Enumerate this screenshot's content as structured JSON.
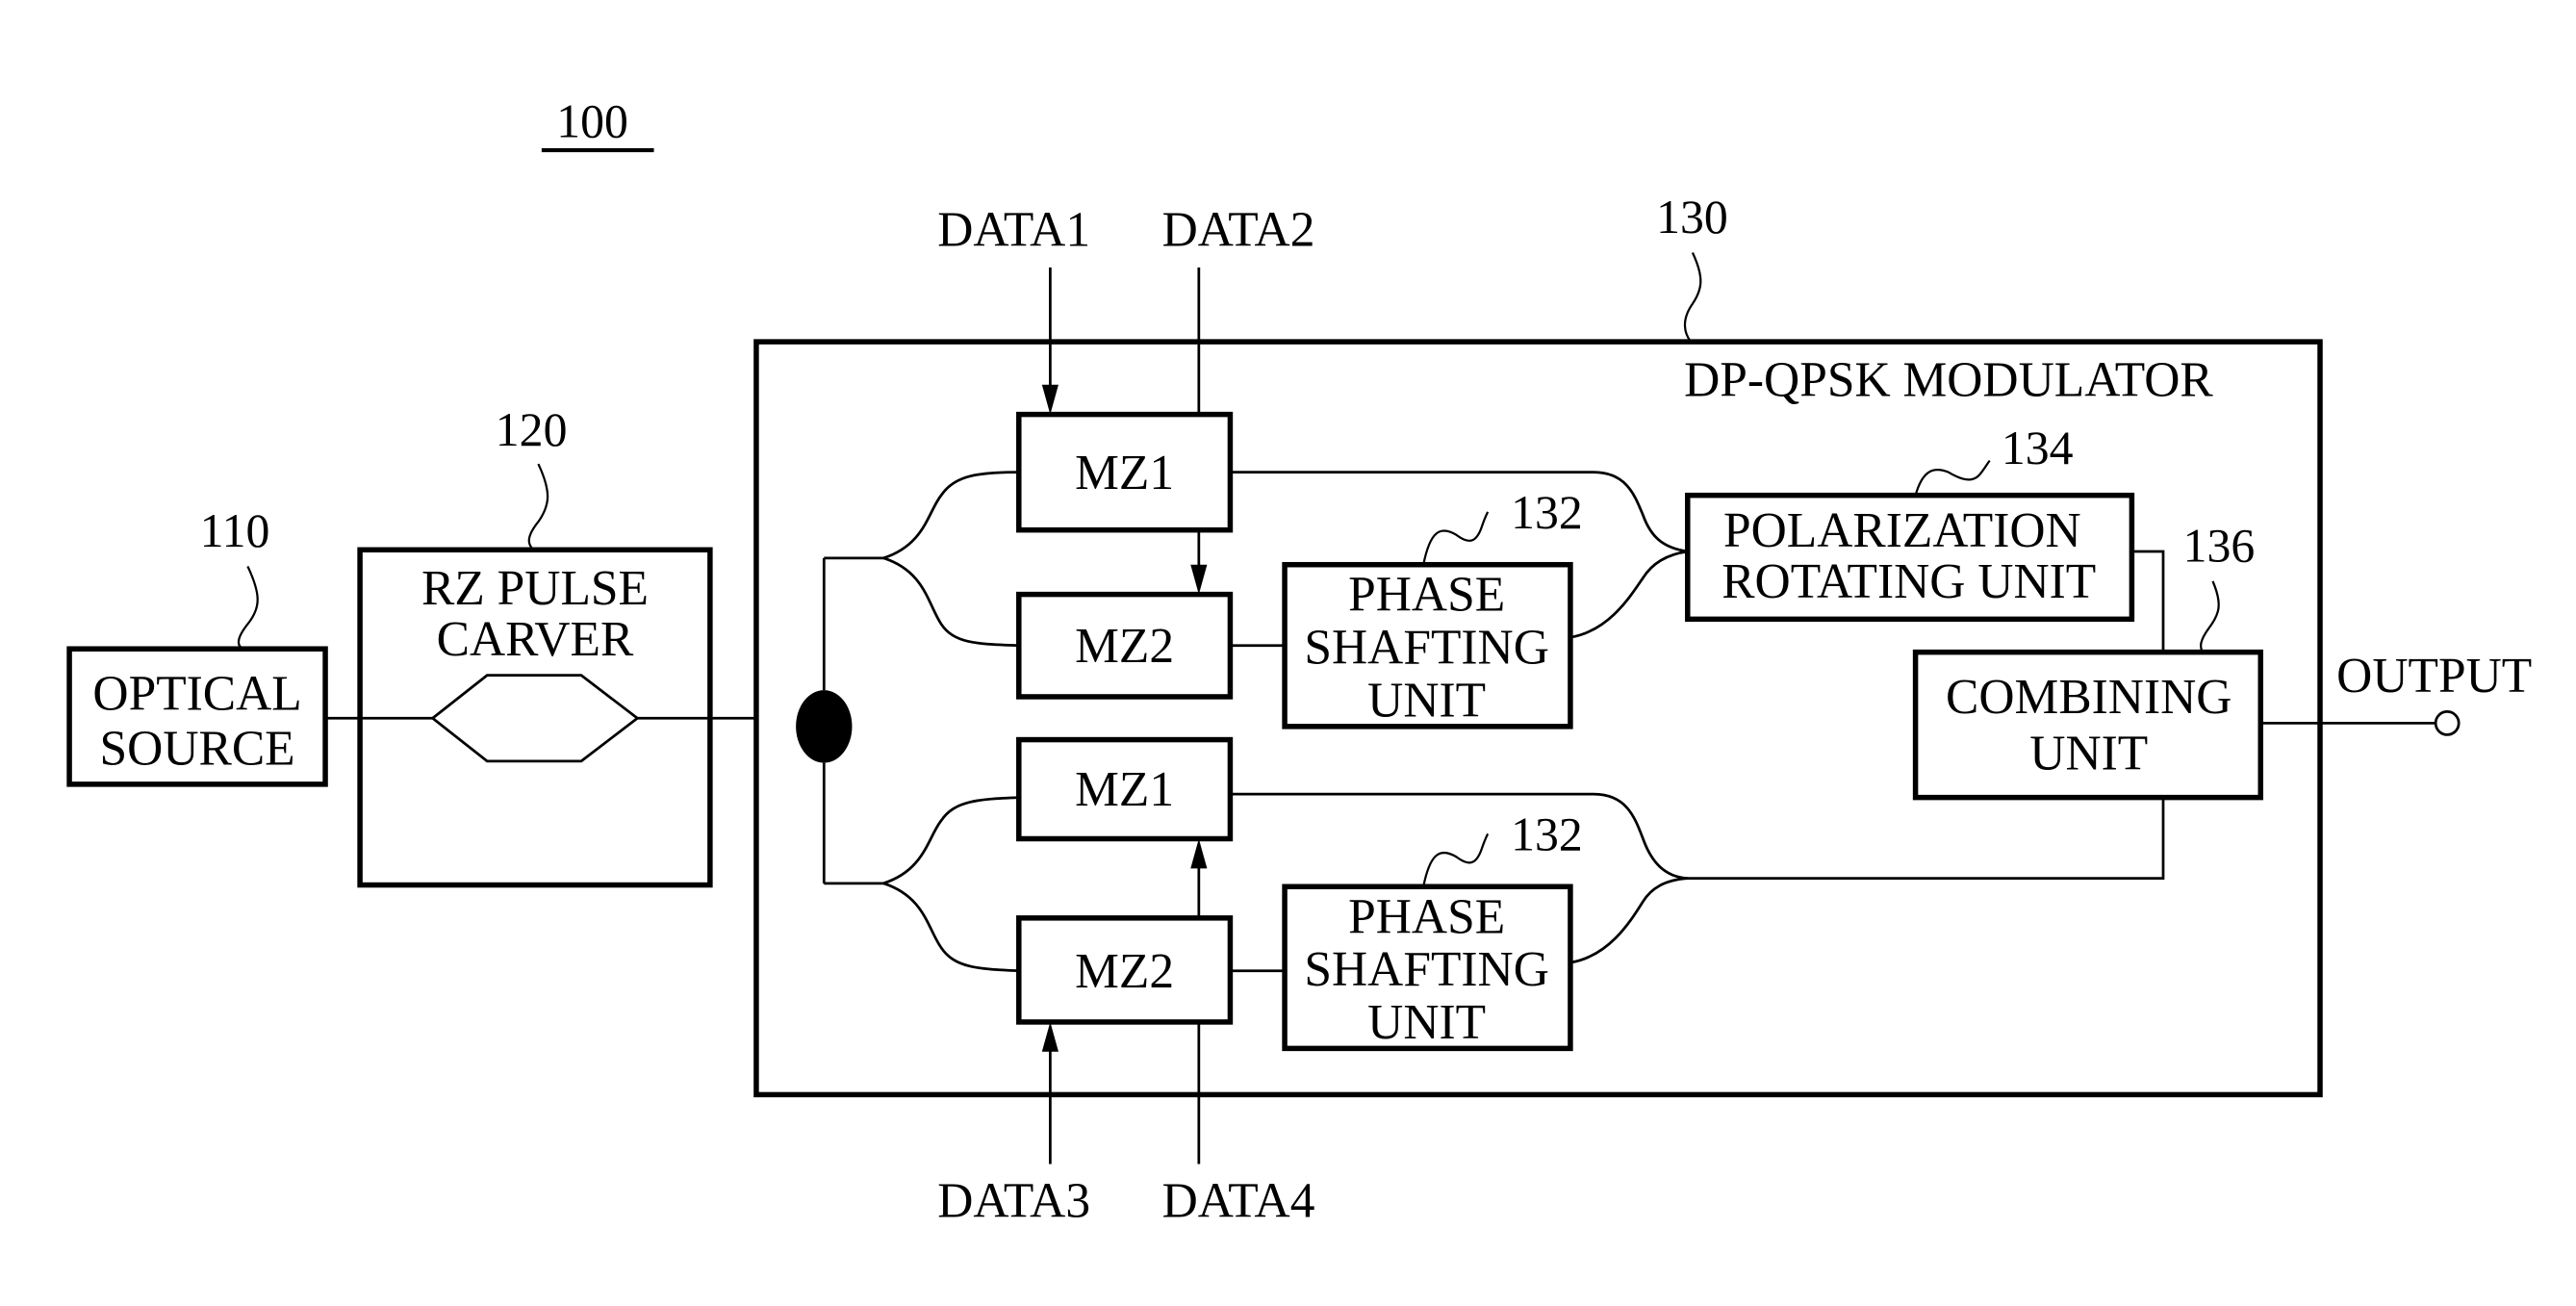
{
  "figure": {
    "ref": "100"
  },
  "optical_source": {
    "ref": "110",
    "line1": "OPTICAL",
    "line2": "SOURCE"
  },
  "pulse_carver": {
    "ref": "120",
    "line1": "RZ PULSE",
    "line2": "CARVER"
  },
  "modulator": {
    "ref": "130",
    "title": "DP-QPSK MODULATOR",
    "upper": {
      "mz1": "MZ1",
      "mz2": "MZ2",
      "data_a": "DATA1",
      "data_b": "DATA2",
      "phase_ref": "132",
      "phase_line1": "PHASE",
      "phase_line2": "SHAFTING",
      "phase_line3": "UNIT"
    },
    "lower": {
      "mz1": "MZ1",
      "mz2": "MZ2",
      "data_a": "DATA3",
      "data_b": "DATA4",
      "phase_ref": "132",
      "phase_line1": "PHASE",
      "phase_line2": "SHAFTING",
      "phase_line3": "UNIT"
    },
    "polarization": {
      "ref": "134",
      "line1": "POLARIZATION",
      "line2": "ROTATING UNIT"
    },
    "combiner": {
      "ref": "136",
      "line1": "COMBINING",
      "line2": "UNIT"
    }
  },
  "output": {
    "label": "OUTPUT"
  }
}
